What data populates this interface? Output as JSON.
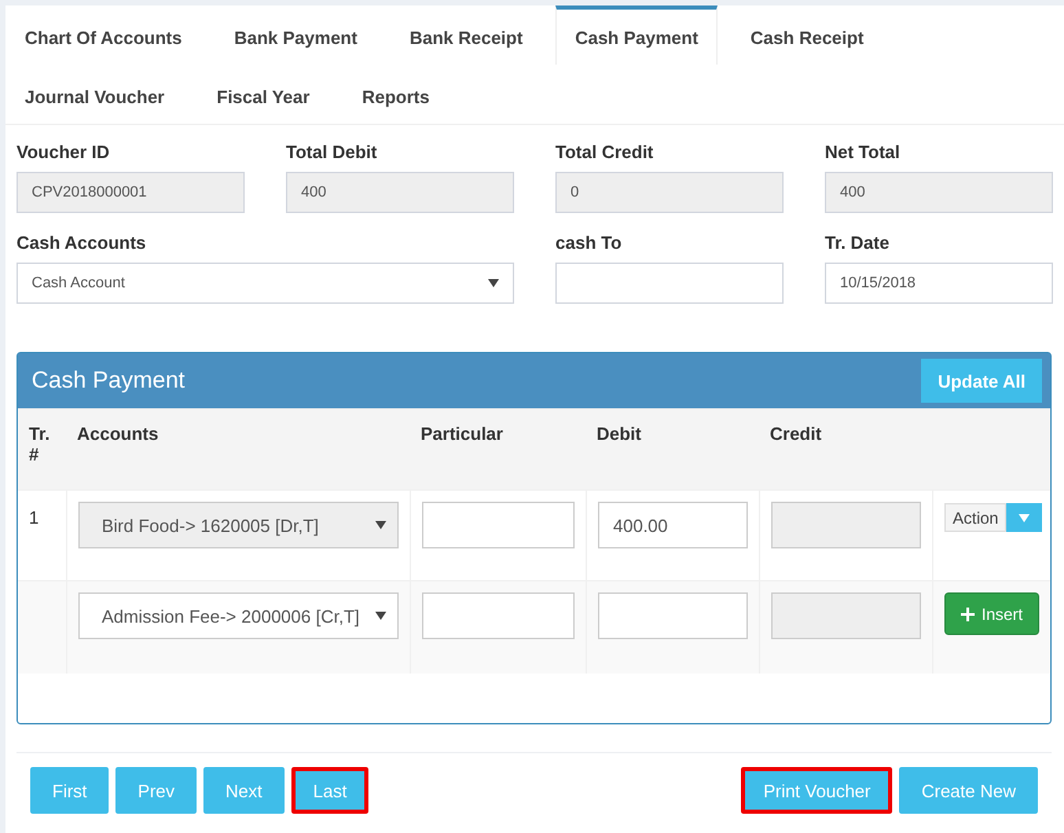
{
  "tabs": [
    {
      "label": "Chart Of Accounts",
      "selected": false
    },
    {
      "label": "Bank Payment",
      "selected": false
    },
    {
      "label": "Bank Receipt",
      "selected": false
    },
    {
      "label": "Cash Payment",
      "selected": true
    },
    {
      "label": "Cash Receipt",
      "selected": false
    },
    {
      "label": "Journal Voucher",
      "selected": false
    },
    {
      "label": "Fiscal Year",
      "selected": false
    },
    {
      "label": "Reports",
      "selected": false
    }
  ],
  "fields": [
    {
      "label": "Voucher ID",
      "kind": "text",
      "value": "CPV2018000001",
      "readonly": true
    },
    {
      "label": "Total Debit",
      "kind": "text",
      "value": "400",
      "readonly": true
    },
    {
      "label": "Total Credit",
      "kind": "text",
      "value": "0",
      "readonly": true
    },
    {
      "label": "Net Total",
      "kind": "text",
      "value": "400",
      "readonly": true
    },
    {
      "label": "Cash Accounts",
      "kind": "select",
      "value": "Cash Account",
      "readonly": false
    },
    {
      "label": "cash To",
      "kind": "text",
      "readonly": false
    },
    {
      "label": "Tr. Date",
      "kind": "text",
      "value": "10/15/2018",
      "readonly": false
    }
  ],
  "panel": {
    "title": "Cash Payment",
    "update_button": "Update All",
    "columns": [
      "Tr. #",
      "Accounts",
      "Particular",
      "Debit",
      "Credit"
    ],
    "rows": [
      {
        "kind": "saved",
        "number": "1",
        "account": "Bird Food-> 1620005 [Dr,T]",
        "account_disabled": true,
        "debit": "400.00",
        "action": "Action"
      },
      {
        "kind": "new",
        "account": "Admission Fee-> 2000006 [Cr,T]",
        "account_disabled": false,
        "insert": "Insert"
      }
    ]
  },
  "nav_buttons": [
    {
      "label": "First",
      "highlighted": false
    },
    {
      "label": "Prev",
      "highlighted": false
    },
    {
      "label": "Next",
      "highlighted": false
    },
    {
      "label": "Last",
      "highlighted": true
    }
  ],
  "action_buttons": [
    {
      "label": "Print Voucher",
      "highlighted": true
    },
    {
      "label": "Create New",
      "highlighted": false
    }
  ]
}
